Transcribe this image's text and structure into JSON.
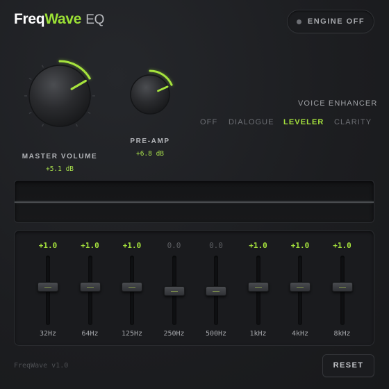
{
  "header": {
    "brand_part1": "Freq",
    "brand_part2": "Wave",
    "brand_part3": "EQ",
    "engine_label": "ENGINE OFF"
  },
  "knobs": {
    "master": {
      "label": "MASTER VOLUME",
      "value": "+5.1 dB",
      "level": 0.2
    },
    "preamp": {
      "label": "PRE-AMP",
      "value": "+6.8 dB",
      "level": 0.22
    }
  },
  "voice_enhancer": {
    "title": "VOICE ENHANCER",
    "modes": [
      "OFF",
      "DIALOGUE",
      "LEVELER",
      "CLARITY"
    ],
    "active": "LEVELER"
  },
  "eq": {
    "bands": [
      {
        "freq": "32Hz",
        "value": "+1.0"
      },
      {
        "freq": "64Hz",
        "value": "+1.0"
      },
      {
        "freq": "125Hz",
        "value": "+1.0"
      },
      {
        "freq": "250Hz",
        "value": "0.0"
      },
      {
        "freq": "500Hz",
        "value": "0.0"
      },
      {
        "freq": "1kHz",
        "value": "+1.0"
      },
      {
        "freq": "4kHz",
        "value": "+1.0"
      },
      {
        "freq": "8kHz",
        "value": "+1.0"
      }
    ]
  },
  "footer": {
    "version": "FreqWave v1.0",
    "reset_label": "RESET"
  },
  "colors": {
    "accent": "#a6e33d",
    "background": "#1d1e21",
    "inactive_text": "#6e7075"
  }
}
